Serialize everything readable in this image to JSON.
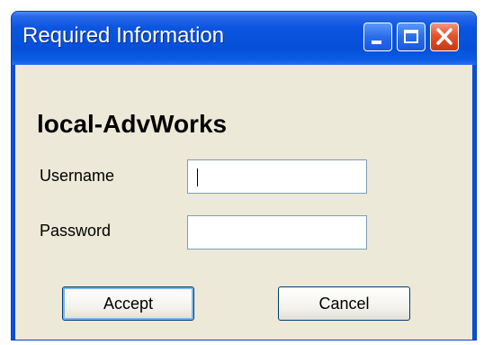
{
  "window": {
    "title": "Required Information",
    "controls": {
      "minimize": "minimize-icon",
      "maximize": "maximize-icon",
      "close": "close-icon"
    }
  },
  "form": {
    "heading": "local-AdvWorks",
    "username_label": "Username",
    "username_value": "",
    "password_label": "Password",
    "password_value": ""
  },
  "buttons": {
    "accept": "Accept",
    "cancel": "Cancel"
  },
  "colors": {
    "titlebar": "#0650d8",
    "client": "#ece9d8",
    "close_button": "#e2532a",
    "input_border": "#7f9db9"
  }
}
